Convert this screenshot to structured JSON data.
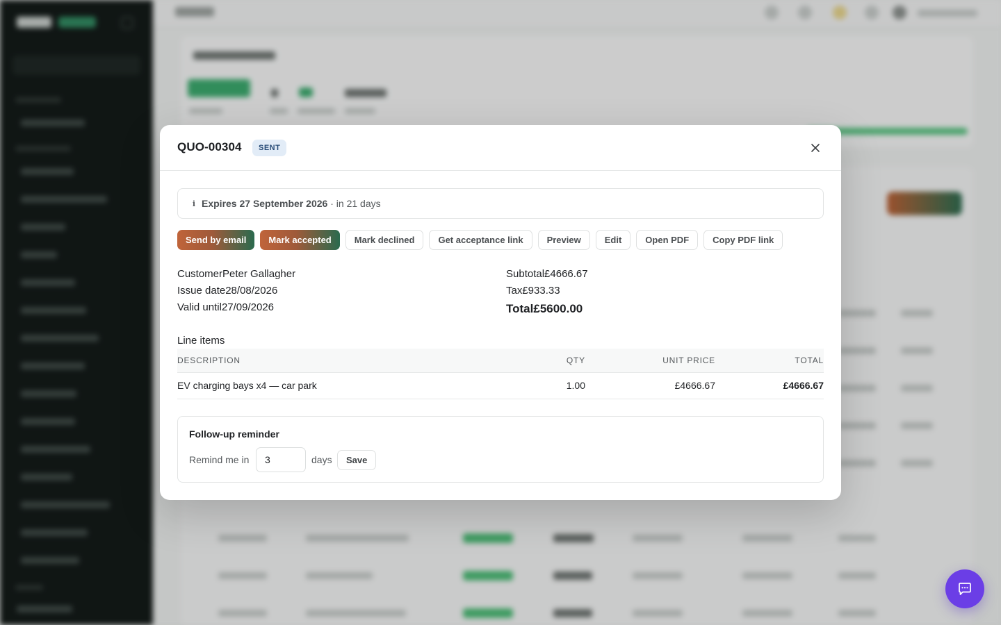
{
  "modal": {
    "title": "QUO-00304",
    "status": "SENT",
    "expiry": {
      "date_text": "Expires 27 September 2026",
      "relative_text": " · in 21 days"
    },
    "actions": [
      {
        "label": "Send by email"
      },
      {
        "label": "Mark accepted"
      },
      {
        "label": "Mark declined"
      },
      {
        "label": "Get acceptance link"
      },
      {
        "label": "Preview"
      },
      {
        "label": "Edit"
      },
      {
        "label": "Open PDF"
      },
      {
        "label": "Copy PDF link"
      }
    ],
    "meta_left": [
      {
        "label": "Customer",
        "value": "Peter Gallagher"
      },
      {
        "label": "Issue date",
        "value": "28/08/2026"
      },
      {
        "label": "Valid until",
        "value": "27/09/2026"
      }
    ],
    "meta_right": [
      {
        "label": "Subtotal",
        "value": "£4666.67"
      },
      {
        "label": "Tax",
        "value": "£933.33"
      },
      {
        "label": "Total",
        "value": "£5600.00"
      }
    ],
    "line_items": {
      "title": "Line items",
      "columns": [
        "DESCRIPTION",
        "QTY",
        "UNIT PRICE",
        "TOTAL"
      ],
      "rows": [
        {
          "description": "EV charging bays x4 — car park",
          "qty": "1.00",
          "unit_price": "£4666.67",
          "total": "£4666.67"
        }
      ]
    },
    "reminder": {
      "title": "Follow-up reminder",
      "label": "Remind me in",
      "value": "3",
      "unit": "days",
      "save_label": "Save"
    }
  },
  "colors": {
    "primary_gradient_start": "#c0643a",
    "primary_gradient_end": "#2a6a4e",
    "status_bg": "#e2ecf7",
    "status_text": "#2a4d78",
    "chat_fab": "#6b3ee6"
  },
  "icons": {
    "close": "close-icon",
    "info": "info-icon",
    "chat": "chat-icon"
  }
}
